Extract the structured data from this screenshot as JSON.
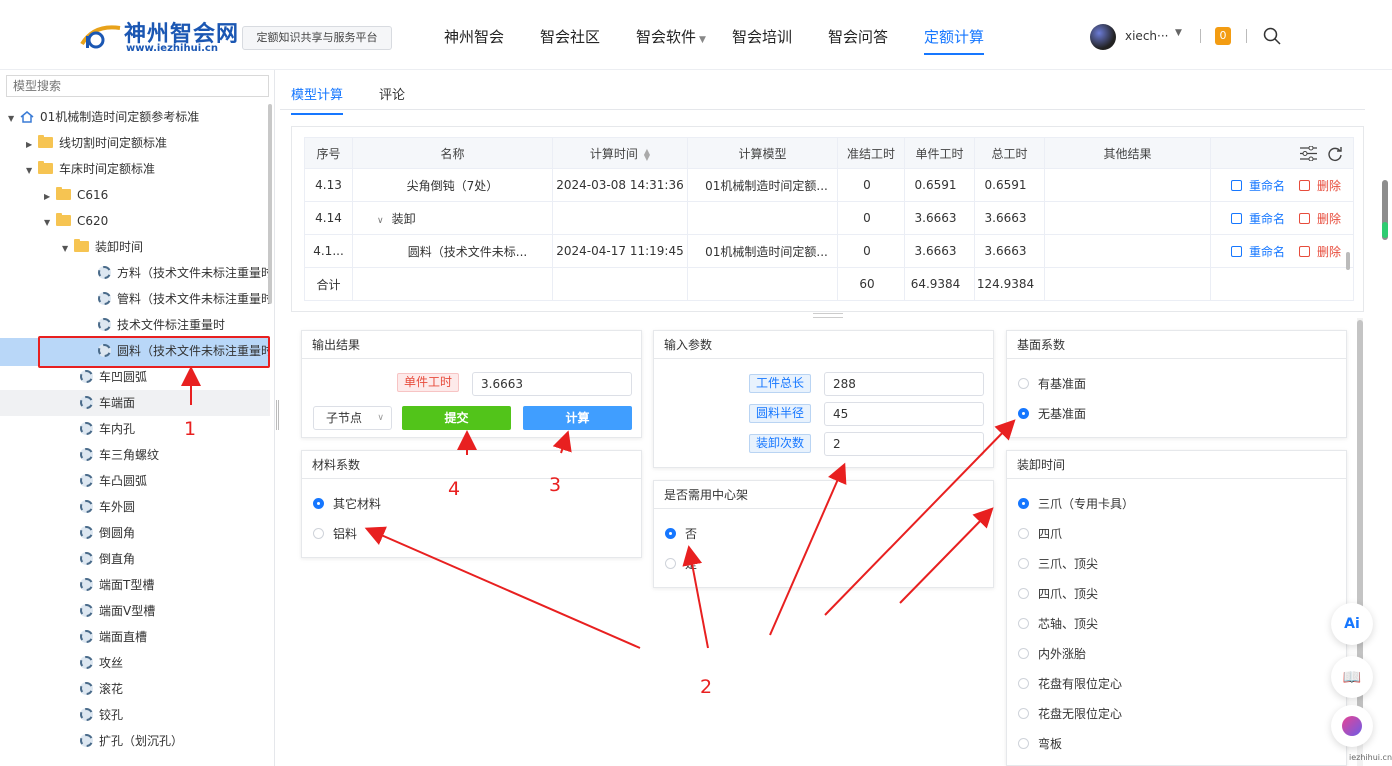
{
  "header": {
    "logo_text": "神州智会网",
    "logo_url": "www.iezhihui.cn",
    "platform_label": "定额知识共享与服务平台",
    "nav": [
      {
        "label": "神州智会",
        "active": false,
        "has_caret": false
      },
      {
        "label": "智会社区",
        "active": false,
        "has_caret": false
      },
      {
        "label": "智会软件",
        "active": false,
        "has_caret": true
      },
      {
        "label": "智会培训",
        "active": false,
        "has_caret": false
      },
      {
        "label": "智会问答",
        "active": false,
        "has_caret": false
      },
      {
        "label": "定额计算",
        "active": true,
        "has_caret": false
      }
    ],
    "user_name": "xiech···",
    "notification_count": "0"
  },
  "sidebar": {
    "search_placeholder": "模型搜索",
    "tree": [
      {
        "label": "01机械制造时间定额参考标准",
        "icon": "home-icon",
        "expanded": true
      },
      {
        "label": "线切割时间定额标准",
        "icon": "folder-icon",
        "expanded": false
      },
      {
        "label": "车床时间定额标准",
        "icon": "folder-icon",
        "expanded": true
      },
      {
        "label": "C616",
        "icon": "folder-icon",
        "expanded": false
      },
      {
        "label": "C620",
        "icon": "folder-icon",
        "expanded": true
      },
      {
        "label": "装卸时间",
        "icon": "folder-icon",
        "expanded": true
      },
      {
        "label": "方料（技术文件未标注重量时）",
        "icon": "gear-icon"
      },
      {
        "label": "管料（技术文件未标注重量时）",
        "icon": "gear-icon"
      },
      {
        "label": "技术文件标注重量时",
        "icon": "gear-icon"
      },
      {
        "label": "圆料（技术文件未标注重量时）",
        "icon": "gear-icon",
        "selected": true
      },
      {
        "label": "车凹圆弧",
        "icon": "gear-icon"
      },
      {
        "label": "车端面",
        "icon": "gear-icon"
      },
      {
        "label": "车内孔",
        "icon": "gear-icon"
      },
      {
        "label": "车三角螺纹",
        "icon": "gear-icon"
      },
      {
        "label": "车凸圆弧",
        "icon": "gear-icon"
      },
      {
        "label": "车外圆",
        "icon": "gear-icon"
      },
      {
        "label": "倒圆角",
        "icon": "gear-icon"
      },
      {
        "label": "倒直角",
        "icon": "gear-icon"
      },
      {
        "label": "端面T型槽",
        "icon": "gear-icon"
      },
      {
        "label": "端面V型槽",
        "icon": "gear-icon"
      },
      {
        "label": "端面直槽",
        "icon": "gear-icon"
      },
      {
        "label": "攻丝",
        "icon": "gear-icon"
      },
      {
        "label": "滚花",
        "icon": "gear-icon"
      },
      {
        "label": "铰孔",
        "icon": "gear-icon"
      },
      {
        "label": "扩孔（划沉孔）",
        "icon": "gear-icon"
      }
    ]
  },
  "tabs": [
    {
      "label": "模型计算",
      "active": true
    },
    {
      "label": "评论",
      "active": false
    }
  ],
  "table": {
    "columns": [
      "序号",
      "名称",
      "计算时间",
      "计算模型",
      "准结工时",
      "单件工时",
      "总工时",
      "其他结果"
    ],
    "rows": [
      {
        "seq": "4.13",
        "name": "尖角倒钝（7处）",
        "time": "2024-03-08 14:31:36",
        "model": "01机械制造时间定额...",
        "prep": "0",
        "unit": "0.6591",
        "total": "0.6591",
        "other": ""
      },
      {
        "seq": "4.14",
        "name": "装卸",
        "time": "",
        "model": "",
        "prep": "0",
        "unit": "3.6663",
        "total": "3.6663",
        "other": "",
        "collapsible": true
      },
      {
        "seq": "4.1...",
        "name": "圆料（技术文件未标...",
        "time": "2024-04-17 11:19:45",
        "model": "01机械制造时间定额...",
        "prep": "0",
        "unit": "3.6663",
        "total": "3.6663",
        "other": ""
      }
    ],
    "summary": {
      "label": "合计",
      "prep": "60",
      "unit": "64.9384",
      "total": "124.9384"
    },
    "rename_label": "重命名",
    "delete_label": "删除"
  },
  "output": {
    "title": "输出结果",
    "unit_time_label": "单件工时",
    "unit_time_value": "3.6663",
    "node_select": "子节点",
    "submit_label": "提交",
    "calc_label": "计算"
  },
  "material": {
    "title": "材料系数",
    "options": [
      {
        "label": "其它材料",
        "checked": true
      },
      {
        "label": "铝料",
        "checked": false
      }
    ]
  },
  "inputs": {
    "title": "输入参数",
    "params": [
      {
        "label": "工件总长",
        "value": "288"
      },
      {
        "label": "圆料半径",
        "value": "45"
      },
      {
        "label": "装卸次数",
        "value": "2"
      }
    ]
  },
  "center_frame": {
    "title": "是否需用中心架",
    "options": [
      {
        "label": "否",
        "checked": true
      },
      {
        "label": "是",
        "checked": false
      }
    ]
  },
  "base": {
    "title": "基面系数",
    "options": [
      {
        "label": "有基准面",
        "checked": false
      },
      {
        "label": "无基准面",
        "checked": true
      }
    ]
  },
  "loading": {
    "title": "装卸时间",
    "options": [
      {
        "label": "三爪（专用卡具）",
        "checked": true
      },
      {
        "label": "四爪",
        "checked": false
      },
      {
        "label": "三爪、顶尖",
        "checked": false
      },
      {
        "label": "四爪、顶尖",
        "checked": false
      },
      {
        "label": "芯轴、顶尖",
        "checked": false
      },
      {
        "label": "内外涨胎",
        "checked": false
      },
      {
        "label": "花盘有限位定心",
        "checked": false
      },
      {
        "label": "花盘无限位定心",
        "checked": false
      },
      {
        "label": "弯板",
        "checked": false
      }
    ]
  },
  "float_buttons": {
    "ai_label": "Ai"
  },
  "watermark": "iezhihui.cn",
  "annotations": {
    "a1": "1",
    "a2": "2",
    "a3": "3",
    "a4": "4"
  },
  "colors": {
    "accent": "#1677ff",
    "submit": "#52c41a",
    "danger": "#e74c3c",
    "annotation": "#e82020"
  }
}
